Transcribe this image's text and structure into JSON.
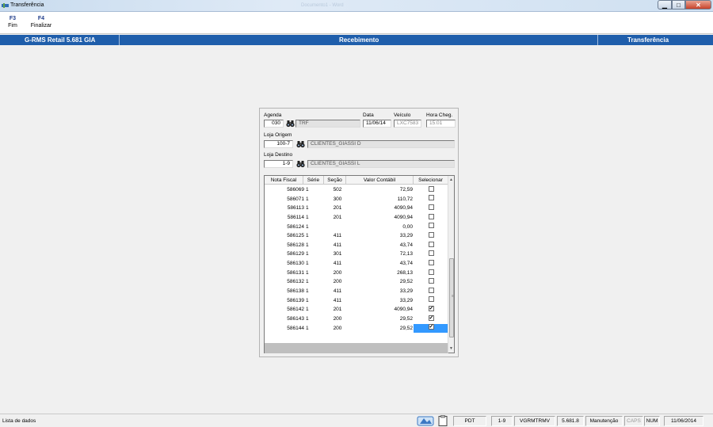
{
  "window": {
    "title": "Transferência",
    "background_title": "Documento1 - Word"
  },
  "toolbar": {
    "keys": [
      {
        "key": "F3",
        "label": "Fim"
      },
      {
        "key": "F4",
        "label": "Finalizar"
      }
    ]
  },
  "header": {
    "app": "G-RMS Retail 5.681 GIA",
    "module": "Recebimento",
    "screen": "Transferência"
  },
  "form": {
    "agenda_label": "Agenda",
    "agenda_value": "030",
    "agenda_desc": "TRF",
    "data_label": "Data",
    "data_value": "11/06/14",
    "veiculo_label": "Veículo",
    "veiculo_value": "LXC7583",
    "hora_label": "Hora Cheg.",
    "hora_value": "15:01",
    "origem_label": "Loja Origem",
    "origem_value": "100-7",
    "origem_desc": "CLIENTES_GIASSI D",
    "destino_label": "Loja Destino",
    "destino_value": "1-9",
    "destino_desc": "CLIENTES_GIASSI L"
  },
  "grid": {
    "columns": [
      "Nota Fiscal",
      "Série",
      "Seção",
      "Valor Contábil",
      "Selecionar"
    ],
    "rows": [
      {
        "nf": "586069",
        "serie": "1",
        "secao": "502",
        "valor": "72,59",
        "checked": false,
        "selected": false
      },
      {
        "nf": "586071",
        "serie": "1",
        "secao": "300",
        "valor": "110,72",
        "checked": false,
        "selected": false
      },
      {
        "nf": "586113",
        "serie": "1",
        "secao": "201",
        "valor": "4090,94",
        "checked": false,
        "selected": false
      },
      {
        "nf": "586114",
        "serie": "1",
        "secao": "201",
        "valor": "4090,94",
        "checked": false,
        "selected": false
      },
      {
        "nf": "586124",
        "serie": "1",
        "secao": "",
        "valor": "0,00",
        "checked": false,
        "selected": false
      },
      {
        "nf": "586125",
        "serie": "1",
        "secao": "411",
        "valor": "33,29",
        "checked": false,
        "selected": false
      },
      {
        "nf": "586128",
        "serie": "1",
        "secao": "411",
        "valor": "43,74",
        "checked": false,
        "selected": false
      },
      {
        "nf": "586129",
        "serie": "1",
        "secao": "301",
        "valor": "72,13",
        "checked": false,
        "selected": false
      },
      {
        "nf": "586130",
        "serie": "1",
        "secao": "411",
        "valor": "43,74",
        "checked": false,
        "selected": false
      },
      {
        "nf": "586131",
        "serie": "1",
        "secao": "200",
        "valor": "268,13",
        "checked": false,
        "selected": false
      },
      {
        "nf": "586132",
        "serie": "1",
        "secao": "200",
        "valor": "29,52",
        "checked": false,
        "selected": false
      },
      {
        "nf": "586138",
        "serie": "1",
        "secao": "411",
        "valor": "33,29",
        "checked": false,
        "selected": false
      },
      {
        "nf": "586139",
        "serie": "1",
        "secao": "411",
        "valor": "33,29",
        "checked": false,
        "selected": false
      },
      {
        "nf": "586142",
        "serie": "1",
        "secao": "201",
        "valor": "4090,94",
        "checked": true,
        "selected": false
      },
      {
        "nf": "586143",
        "serie": "1",
        "secao": "200",
        "valor": "29,52",
        "checked": true,
        "selected": false
      },
      {
        "nf": "586144",
        "serie": "1",
        "secao": "200",
        "valor": "29,52",
        "checked": true,
        "selected": true
      }
    ]
  },
  "statusbar": {
    "message": "Lista de dados",
    "cells": [
      "PDT",
      "1-9",
      "VGRMTRMV",
      "5.681.8",
      "Manutenção",
      "CAPS",
      "NUM",
      "11/06/2014"
    ]
  },
  "colors": {
    "header_blue": "#1f5eab",
    "selection": "#3399ff",
    "fkey_blue": "#1f3c8a"
  }
}
